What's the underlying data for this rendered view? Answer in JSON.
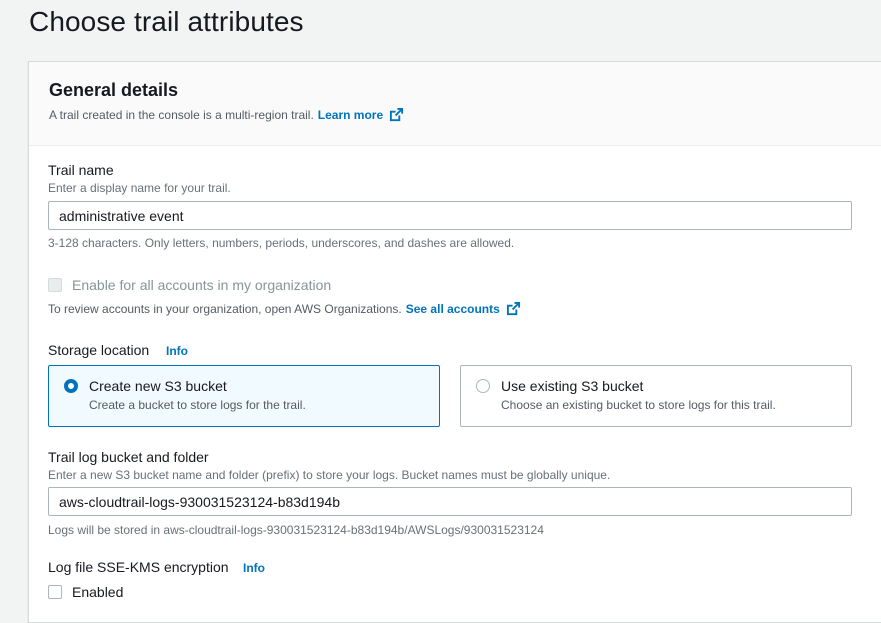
{
  "page": {
    "title": "Choose trail attributes"
  },
  "general": {
    "title": "General details",
    "description": "A trail created in the console is a multi-region trail.",
    "learn_more": "Learn more"
  },
  "trail_name": {
    "label": "Trail name",
    "description": "Enter a display name for your trail.",
    "value": "administrative event",
    "constraint": "3-128 characters. Only letters, numbers, periods, underscores, and dashes are allowed."
  },
  "organization": {
    "checkbox_label": "Enable for all accounts in my organization",
    "note": "To review accounts in your organization, open AWS Organizations.",
    "link": "See all accounts"
  },
  "storage": {
    "label": "Storage location",
    "info": "Info",
    "options": [
      {
        "label": "Create new S3 bucket",
        "description": "Create a bucket to store logs for the trail.",
        "selected": true
      },
      {
        "label": "Use existing S3 bucket",
        "description": "Choose an existing bucket to store logs for this trail.",
        "selected": false
      }
    ]
  },
  "bucket": {
    "label": "Trail log bucket and folder",
    "description": "Enter a new S3 bucket name and folder (prefix) to store your logs. Bucket names must be globally unique.",
    "value": "aws-cloudtrail-logs-930031523124-b83d194b",
    "note": "Logs will be stored in aws-cloudtrail-logs-930031523124-b83d194b/AWSLogs/930031523124"
  },
  "encryption": {
    "label": "Log file SSE-KMS encryption",
    "info": "Info",
    "checkbox_label": "Enabled"
  },
  "colors": {
    "accent": "#0073bb",
    "text": "#16191f",
    "muted": "#687078"
  }
}
